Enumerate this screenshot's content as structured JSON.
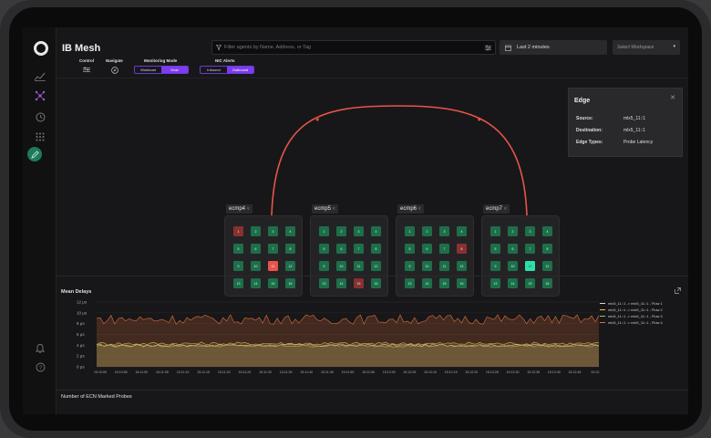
{
  "app": {
    "title": "IB Mesh"
  },
  "search": {
    "placeholder": "Filter agents by Name, Address, or Tag"
  },
  "time_range": {
    "label": "Last 2 minutes"
  },
  "workspace": {
    "placeholder": "Select Workspace"
  },
  "controls": {
    "control_label": "Control",
    "navigate_label": "Navigate",
    "monitoring_mode": {
      "label": "Monitoring Mode",
      "options": [
        "Workload",
        "Host"
      ],
      "selected": "Host"
    },
    "nic_alerts": {
      "label": "NIC Alerts",
      "options": [
        "Inbound",
        "Outbound"
      ],
      "selected": "Outbound"
    }
  },
  "groups": [
    {
      "name": "ecmp4",
      "cells": [
        {
          "n": "1",
          "s": "r"
        },
        {
          "n": "2",
          "s": "g"
        },
        {
          "n": "3",
          "s": "g"
        },
        {
          "n": "4",
          "s": "g"
        },
        {
          "n": "5",
          "s": "g"
        },
        {
          "n": "6",
          "s": "g"
        },
        {
          "n": "7",
          "s": "g"
        },
        {
          "n": "8",
          "s": "g"
        },
        {
          "n": "9",
          "s": "g"
        },
        {
          "n": "10",
          "s": "g"
        },
        {
          "n": "11",
          "s": "hr"
        },
        {
          "n": "12",
          "s": "g"
        },
        {
          "n": "13",
          "s": "g"
        },
        {
          "n": "14",
          "s": "g"
        },
        {
          "n": "15",
          "s": "g"
        },
        {
          "n": "16",
          "s": "g"
        }
      ]
    },
    {
      "name": "ecmp5",
      "cells": [
        {
          "n": "1",
          "s": "g"
        },
        {
          "n": "2",
          "s": "g"
        },
        {
          "n": "3",
          "s": "g"
        },
        {
          "n": "4",
          "s": "g"
        },
        {
          "n": "5",
          "s": "g"
        },
        {
          "n": "6",
          "s": "g"
        },
        {
          "n": "7",
          "s": "g"
        },
        {
          "n": "8",
          "s": "g"
        },
        {
          "n": "9",
          "s": "g"
        },
        {
          "n": "10",
          "s": "g"
        },
        {
          "n": "11",
          "s": "g"
        },
        {
          "n": "12",
          "s": "g"
        },
        {
          "n": "13",
          "s": "g"
        },
        {
          "n": "14",
          "s": "g"
        },
        {
          "n": "15",
          "s": "r"
        },
        {
          "n": "16",
          "s": "g"
        }
      ]
    },
    {
      "name": "ecmp6",
      "cells": [
        {
          "n": "1",
          "s": "g"
        },
        {
          "n": "2",
          "s": "g"
        },
        {
          "n": "3",
          "s": "g"
        },
        {
          "n": "4",
          "s": "g"
        },
        {
          "n": "5",
          "s": "g"
        },
        {
          "n": "6",
          "s": "g"
        },
        {
          "n": "7",
          "s": "g"
        },
        {
          "n": "8",
          "s": "r"
        },
        {
          "n": "9",
          "s": "g"
        },
        {
          "n": "10",
          "s": "g"
        },
        {
          "n": "11",
          "s": "g"
        },
        {
          "n": "12",
          "s": "g"
        },
        {
          "n": "13",
          "s": "g"
        },
        {
          "n": "14",
          "s": "g"
        },
        {
          "n": "15",
          "s": "g"
        },
        {
          "n": "16",
          "s": "g"
        }
      ]
    },
    {
      "name": "ecmp7",
      "cells": [
        {
          "n": "1",
          "s": "g"
        },
        {
          "n": "2",
          "s": "g"
        },
        {
          "n": "3",
          "s": "g"
        },
        {
          "n": "4",
          "s": "g"
        },
        {
          "n": "5",
          "s": "g"
        },
        {
          "n": "6",
          "s": "g"
        },
        {
          "n": "7",
          "s": "g"
        },
        {
          "n": "8",
          "s": "g"
        },
        {
          "n": "9",
          "s": "g"
        },
        {
          "n": "10",
          "s": "g"
        },
        {
          "n": "11",
          "s": "hg"
        },
        {
          "n": "12",
          "s": "g"
        },
        {
          "n": "13",
          "s": "g"
        },
        {
          "n": "14",
          "s": "g"
        },
        {
          "n": "15",
          "s": "g"
        },
        {
          "n": "16",
          "s": "g"
        }
      ]
    }
  ],
  "edge_panel": {
    "title": "Edge",
    "source_label": "Source:",
    "source": "mlx5_11::1",
    "destination_label": "Destination:",
    "destination": "mlx5_11::1",
    "types_label": "Edge Types:",
    "types": "Probe Latency"
  },
  "colors": {
    "accent": "#7c3cf0",
    "edge": "#e8544a",
    "ok": "#1e6e4a",
    "bad": "#8a3030",
    "dest": "#2de0a8"
  },
  "chart_title": "Mean Delays",
  "ecn_title": "Number of ECN Marked Probes",
  "chart_data": {
    "type": "area",
    "title": "Mean Delays",
    "y_ticks": [
      "12 μs",
      "10 μs",
      "8 μs",
      "6 μs",
      "4 μs",
      "2 μs",
      "0 μs"
    ],
    "ylim": [
      0,
      12
    ],
    "x_ticks": [
      "15:10:50",
      "15:10:55",
      "15:11:00",
      "15:11:05",
      "15:11:10",
      "15:11:15",
      "15:11:20",
      "15:11:25",
      "15:11:30",
      "15:11:35",
      "15:11:40",
      "15:11:45",
      "15:11:50",
      "15:11:55",
      "15:12:00",
      "15:12:05",
      "15:12:10",
      "15:12:15",
      "15:12:20",
      "15:12:25",
      "15:12:30",
      "15:12:35",
      "15:12:40",
      "15:12:45",
      "15:12:"
    ],
    "series": [
      {
        "name": "mlx5_11::1 -> mlx5_11::1 - Flow 1",
        "color": "#d9d9d9",
        "base": 4.0,
        "amp": 0.25
      },
      {
        "name": "mlx5_11::1 -> mlx5_11::1 - Flow 2",
        "color": "#e8c33a",
        "base": 4.3,
        "amp": 0.3
      },
      {
        "name": "mlx5_11::1 -> mlx5_11::1 - Flow 3",
        "color": "#8fc86a",
        "base": 3.9,
        "amp": 0.25
      },
      {
        "name": "mlx5_11::1 -> mlx5_11::1 - Flow 4",
        "color": "#e0703a",
        "base": 8.8,
        "amp": 0.9
      }
    ]
  }
}
